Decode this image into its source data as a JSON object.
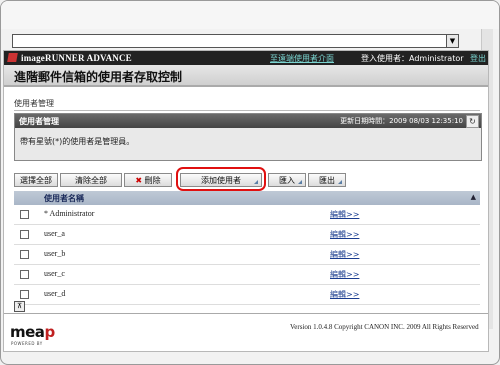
{
  "header": {
    "brand": "imageRUNNER ADVANCE",
    "portal_link": "至遠端使用者介面",
    "login_label": "登入使用者：Administrator",
    "logout_link": "登出"
  },
  "page": {
    "title": "進階郵件信箱的使用者存取控制",
    "breadcrumb": "使用者管理"
  },
  "panel": {
    "heading": "使用者管理",
    "updated": "更新日期時間：2009 08/03 12:35:10",
    "note": "帶有星號(*)的使用者是管理員。"
  },
  "toolbar": {
    "select_all": "選擇全部",
    "clear_all": "清除全部",
    "delete": "刪除",
    "delete_icon": "✖",
    "add_user": "添加使用者",
    "import": "匯入",
    "export": "匯出"
  },
  "table": {
    "header": "使用者名稱",
    "rows": [
      {
        "name": "* Administrator",
        "edit": "編輯>>"
      },
      {
        "name": "user_a",
        "edit": "編輯>>"
      },
      {
        "name": "user_b",
        "edit": "編輯>>"
      },
      {
        "name": "user_c",
        "edit": "編輯>>"
      },
      {
        "name": "user_d",
        "edit": "編輯>>"
      }
    ]
  },
  "footer": {
    "logo_main": "mea",
    "logo_p": "p",
    "powered": "POWERED BY",
    "copyright": "Version 1.0.4.8 Copyright CANON INC. 2009 All Rights Reserved"
  },
  "colors": {
    "highlight": "#e01010",
    "header_bg": "#222222",
    "link": "#7ad4d0"
  }
}
